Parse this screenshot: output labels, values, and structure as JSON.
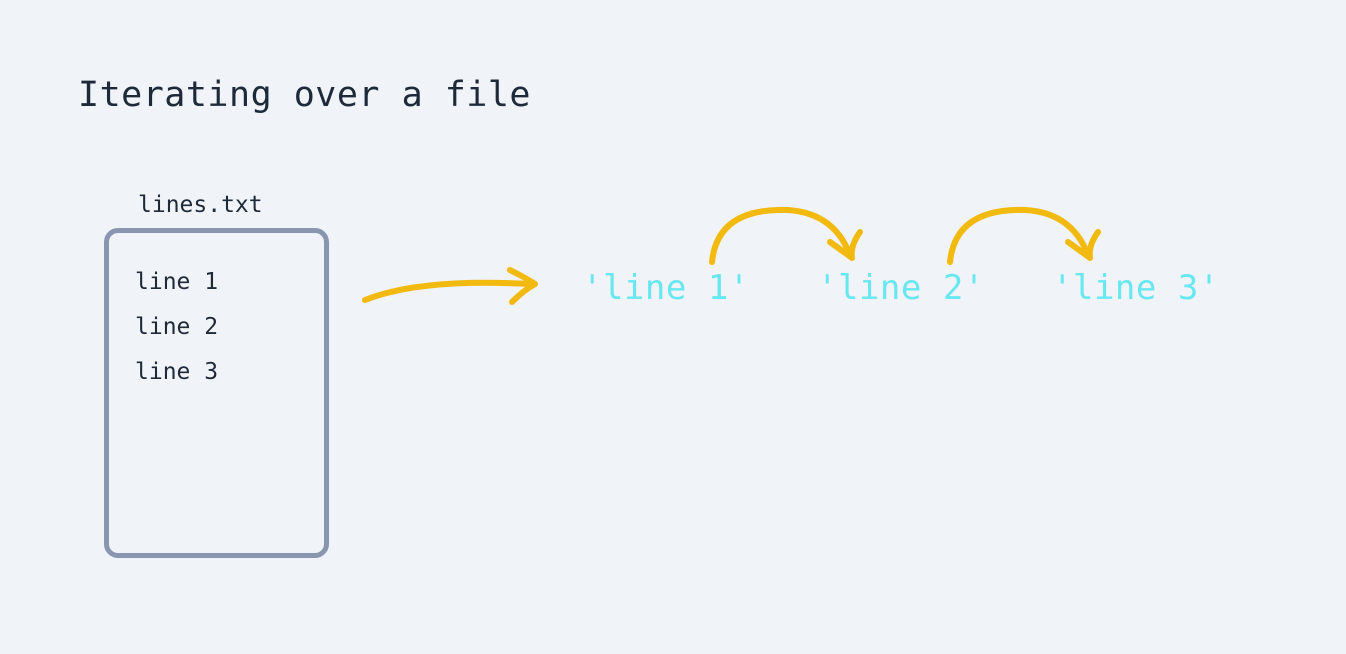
{
  "title": "Iterating over a file",
  "file": {
    "name": "lines.txt",
    "lines": [
      "line 1",
      "line 2",
      "line 3"
    ]
  },
  "outputs": [
    "'line 1'",
    "'line 2'",
    "'line 3'"
  ],
  "colors": {
    "background": "#f0f3f7",
    "text": "#1e2a3a",
    "fileBorder": "#8a96b0",
    "outputText": "#67e8f0",
    "arrow": "#f2b90f"
  }
}
